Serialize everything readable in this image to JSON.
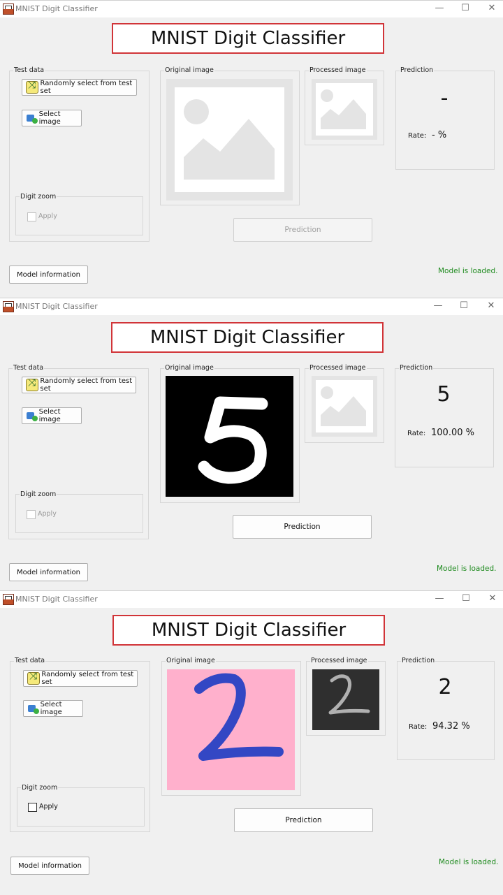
{
  "window_title": "MNIST Digit Classifier",
  "window_controls": {
    "minimize": "—",
    "maximize": "☐",
    "close": "✕"
  },
  "banner_title": "MNIST Digit Classifier",
  "labels": {
    "test_data": "Test data",
    "random_button": "Randomly select from test set",
    "select_button": "Select image",
    "digit_zoom": "Digit zoom",
    "apply": "Apply",
    "original_image": "Original image",
    "processed_image": "Processed image",
    "prediction_group": "Prediction",
    "rate": "Rate:",
    "predict_button": "Prediction",
    "model_info_button": "Model information",
    "status": "Model is loaded."
  },
  "states": [
    {
      "prediction": "-",
      "rate": "- %",
      "apply_enabled": false,
      "prediction_enabled": false,
      "original": "placeholder",
      "processed": "placeholder"
    },
    {
      "prediction": "5",
      "rate": "100.00 %",
      "apply_enabled": false,
      "prediction_enabled": true,
      "original": "digit-5-black",
      "processed": "placeholder"
    },
    {
      "prediction": "2",
      "rate": "94.32 %",
      "apply_enabled": true,
      "prediction_enabled": true,
      "original": "digit-2-pink",
      "processed": "digit-2-dark"
    }
  ],
  "colors": {
    "banner_border": "#d13438",
    "status_green": "#1e8a1e",
    "pink_bg": "#ffb0cc",
    "blue_stroke": "#3347c4"
  }
}
